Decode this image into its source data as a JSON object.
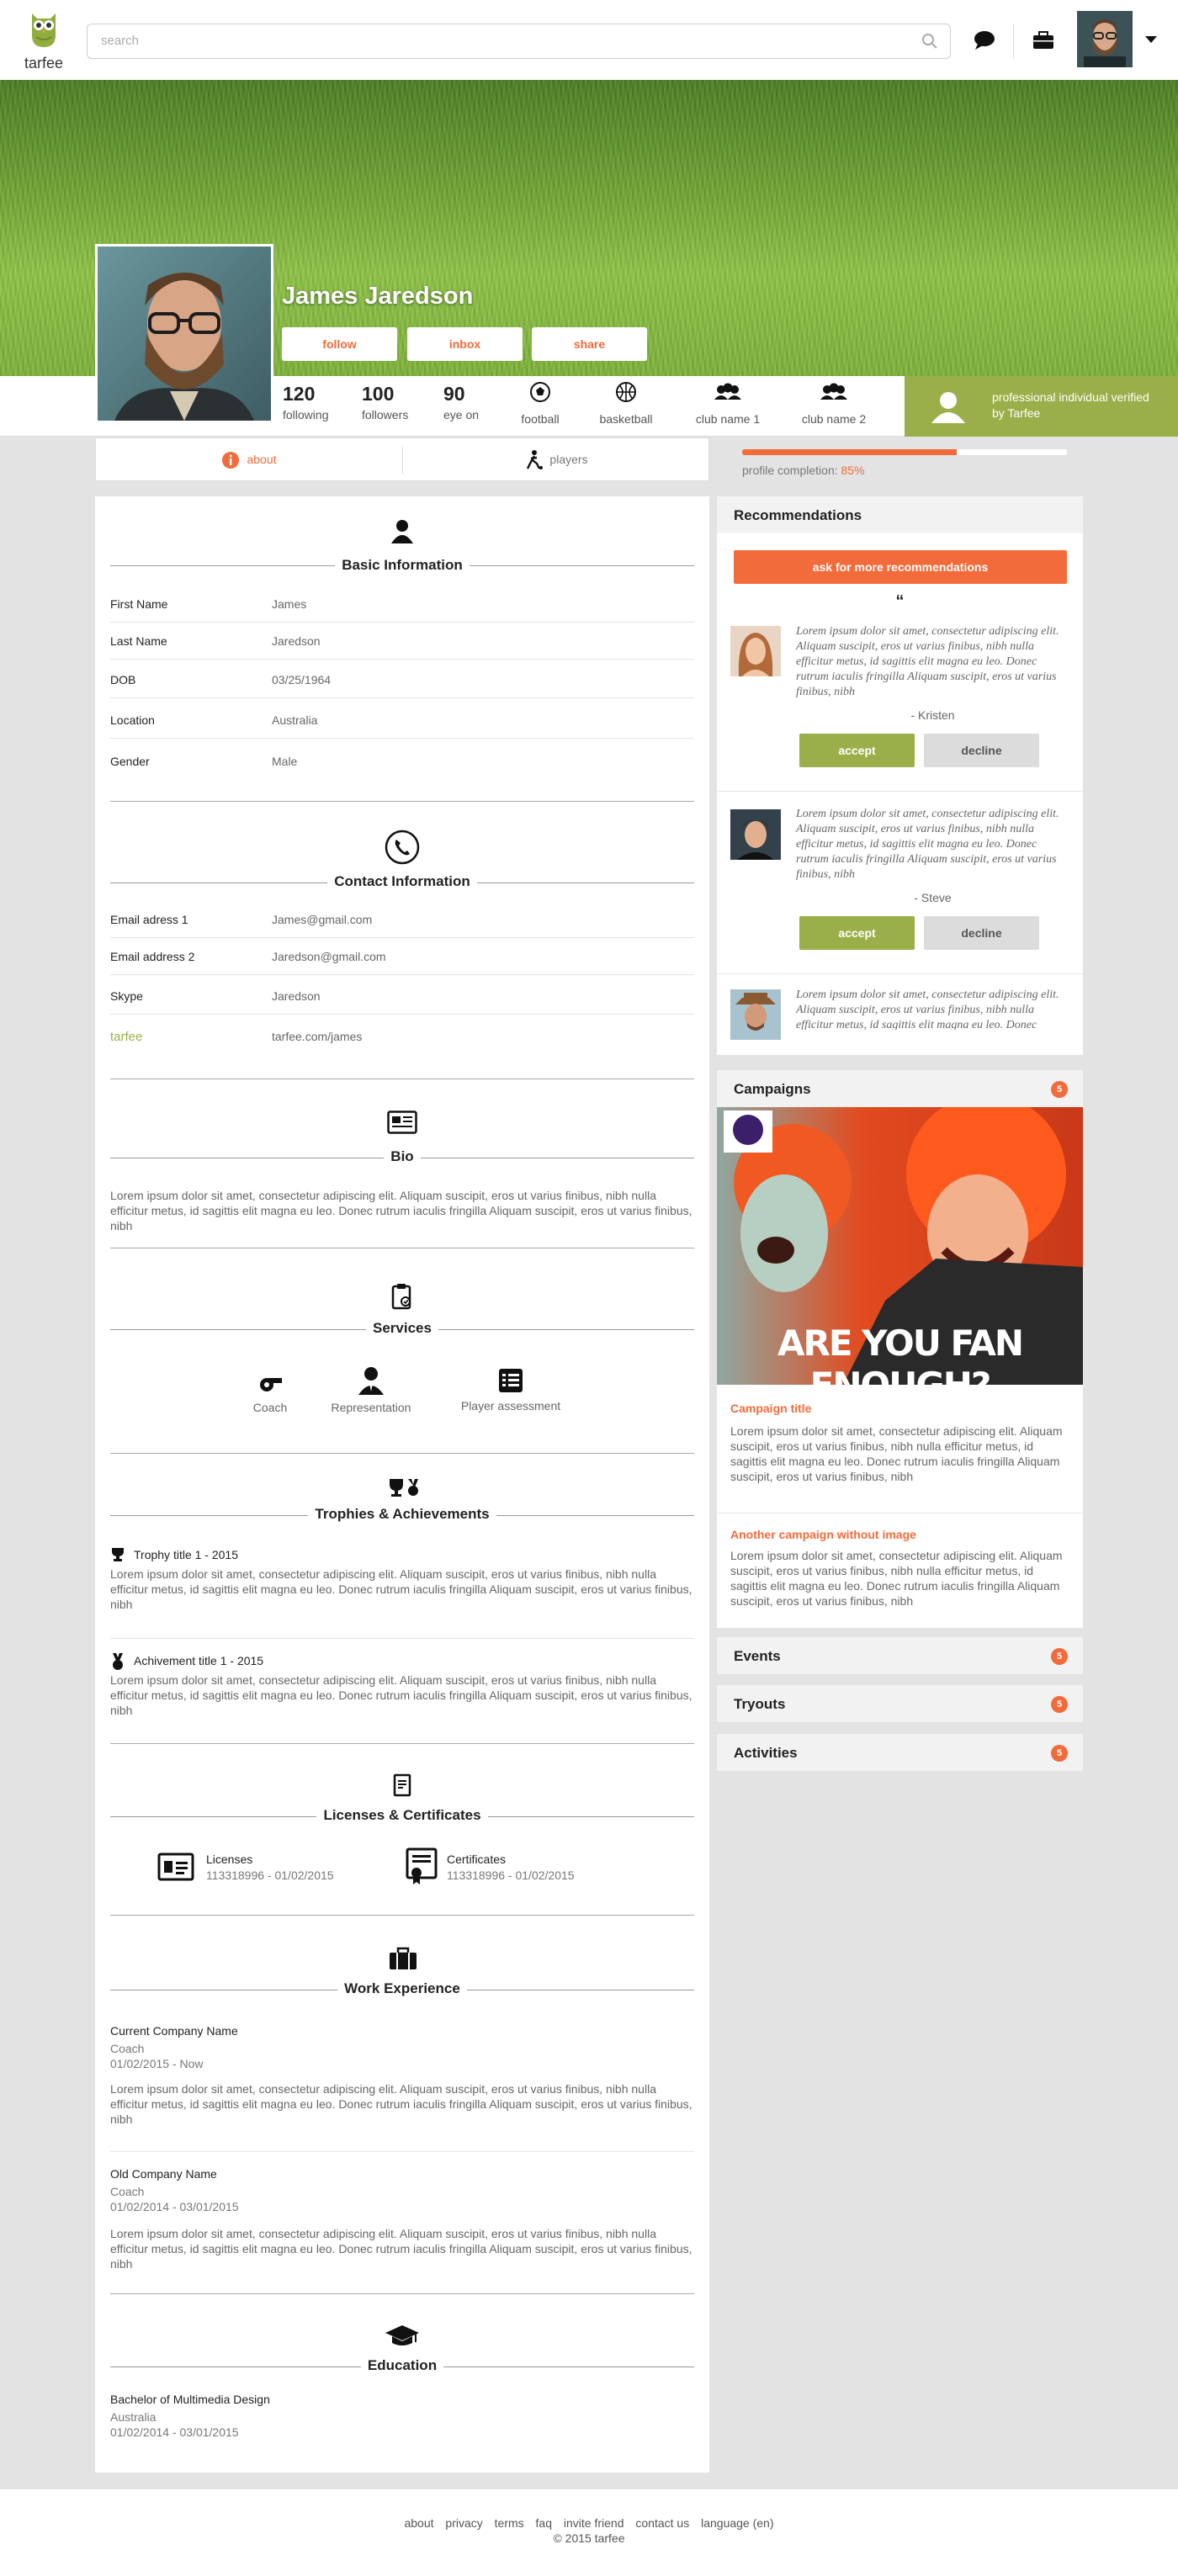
{
  "header": {
    "logo_text": "tarfee",
    "search_placeholder": "search"
  },
  "profile": {
    "name": "James Jaredson",
    "buttons": {
      "follow": "follow",
      "inbox": "inbox",
      "share": "share"
    },
    "stats": [
      {
        "value": "120",
        "label": "following"
      },
      {
        "value": "100",
        "label": "followers"
      },
      {
        "value": "90",
        "label": "eye on"
      }
    ],
    "sports": [
      {
        "label": "football",
        "icon": "football-icon"
      },
      {
        "label": "basketball",
        "icon": "basketball-icon"
      },
      {
        "label": "club name 1",
        "icon": "club-group-icon"
      },
      {
        "label": "club name 2",
        "icon": "club-group-icon"
      }
    ],
    "verified": "professional individual verified by Tarfee"
  },
  "tabs": {
    "about": "about",
    "players": "players"
  },
  "completion": {
    "label": "profile completion:",
    "value": "85%",
    "fraction": 0.66
  },
  "basic": {
    "title": "Basic Information",
    "rows": [
      {
        "k": "First Name",
        "v": "James"
      },
      {
        "k": "Last Name",
        "v": "Jaredson"
      },
      {
        "k": "DOB",
        "v": "03/25/1964"
      },
      {
        "k": "Location",
        "v": "Australia"
      },
      {
        "k": "Gender",
        "v": "Male"
      }
    ]
  },
  "contact": {
    "title": "Contact Information",
    "rows": [
      {
        "k": "Email adress 1",
        "v": "James@gmail.com"
      },
      {
        "k": "Email address 2",
        "v": "Jaredson@gmail.com"
      },
      {
        "k": "Skype",
        "v": "Jaredson"
      },
      {
        "k": "tarfee",
        "v": "tarfee.com/james"
      }
    ]
  },
  "bio": {
    "title": "Bio",
    "text": "Lorem ipsum dolor sit amet, consectetur adipiscing elit. Aliquam suscipit, eros ut varius finibus, nibh nulla efficitur metus, id sagittis elit magna eu leo. Donec rutrum iaculis fringilla Aliquam suscipit, eros ut varius finibus, nibh"
  },
  "services": {
    "title": "Services",
    "items": [
      "Coach",
      "Representation",
      "Player assessment"
    ]
  },
  "trophies": {
    "title": "Trophies & Achievements",
    "items": [
      {
        "title": "Trophy title 1 - 2015",
        "text": "Lorem ipsum dolor sit amet, consectetur adipiscing elit. Aliquam suscipit, eros ut varius finibus, nibh nulla efficitur metus, id sagittis elit magna eu leo. Donec rutrum iaculis fringilla Aliquam suscipit, eros ut varius finibus, nibh"
      },
      {
        "title": "Achivement title 1 - 2015",
        "text": "Lorem ipsum dolor sit amet, consectetur adipiscing elit. Aliquam suscipit, eros ut varius finibus, nibh nulla efficitur metus, id sagittis elit magna eu leo. Donec rutrum iaculis fringilla Aliquam suscipit, eros ut varius finibus, nibh"
      }
    ]
  },
  "licenses": {
    "title": "Licenses & Certificates",
    "items": [
      {
        "label": "Licenses",
        "value": "113318996 - 01/02/2015"
      },
      {
        "label": "Certificates",
        "value": "113318996 - 01/02/2015"
      }
    ]
  },
  "work": {
    "title": "Work Experience",
    "items": [
      {
        "company": "Current Company Name",
        "role": "Coach",
        "dates": "01/02/2015 - Now",
        "text": "Lorem ipsum dolor sit amet, consectetur adipiscing elit. Aliquam suscipit, eros ut varius finibus, nibh nulla efficitur metus, id sagittis elit magna eu leo. Donec rutrum iaculis fringilla Aliquam suscipit, eros ut varius finibus, nibh"
      },
      {
        "company": "Old Company Name",
        "role": "Coach",
        "dates": "01/02/2014 - 03/01/2015",
        "text": "Lorem ipsum dolor sit amet, consectetur adipiscing elit. Aliquam suscipit, eros ut varius finibus, nibh nulla efficitur metus, id sagittis elit magna eu leo. Donec rutrum iaculis fringilla Aliquam suscipit, eros ut varius finibus, nibh"
      }
    ]
  },
  "education": {
    "title": "Education",
    "degree": "Bachelor of Multimedia Design",
    "place": "Australia",
    "dates": "01/02/2014 - 03/01/2015"
  },
  "recommendations": {
    "title": "Recommendations",
    "ask_label": "ask for more recommendations",
    "items": [
      {
        "quote": "Lorem ipsum dolor sit amet, consectetur adipiscing elit. Aliquam suscipit, eros ut varius finibus, nibh nulla efficitur metus, id sagittis elit magna eu leo. Donec rutrum iaculis fringilla Aliquam suscipit, eros ut varius finibus, nibh",
        "author": "- Kristen"
      },
      {
        "quote": "Lorem ipsum dolor sit amet, consectetur adipiscing elit. Aliquam suscipit, eros ut varius finibus, nibh nulla efficitur metus, id sagittis elit magna eu leo. Donec rutrum iaculis fringilla Aliquam suscipit, eros ut varius finibus, nibh",
        "author": "- Steve"
      },
      {
        "quote": "Lorem ipsum dolor sit amet, consectetur adipiscing elit. Aliquam suscipit, eros ut varius finibus, nibh nulla efficitur metus, id sagittis elit magna eu leo. Donec rutrum iaculis fringilla",
        "author": ""
      }
    ],
    "accept": "accept",
    "decline": "decline"
  },
  "campaigns": {
    "title": "Campaigns",
    "count": "5",
    "image_text": "ARE YOU FAN ENOUGH?",
    "items": [
      {
        "title": "Campaign title",
        "text": "Lorem ipsum dolor sit amet, consectetur adipiscing elit. Aliquam suscipit, eros ut varius finibus, nibh nulla efficitur metus, id sagittis elit magna eu leo. Donec rutrum iaculis fringilla Aliquam suscipit, eros ut varius finibus, nibh"
      },
      {
        "title": "Another campaign without image",
        "text": "Lorem ipsum dolor sit amet, consectetur adipiscing elit. Aliquam suscipit, eros ut varius finibus, nibh nulla efficitur metus, id sagittis elit magna eu leo. Donec rutrum iaculis fringilla Aliquam suscipit, eros ut varius finibus, nibh"
      }
    ]
  },
  "events": {
    "title": "Events",
    "count": "5"
  },
  "tryouts": {
    "title": "Tryouts",
    "count": "5"
  },
  "activities": {
    "title": "Activities",
    "count": "5"
  },
  "footer": {
    "links": [
      "about",
      "privacy",
      "terms",
      "faq",
      "invite friend",
      "contact us",
      "language (en)"
    ],
    "copyright": "© 2015 tarfee"
  },
  "colors": {
    "accent": "#f26b3a",
    "green": "#9aaf4a",
    "background": "#e3e3e3"
  }
}
